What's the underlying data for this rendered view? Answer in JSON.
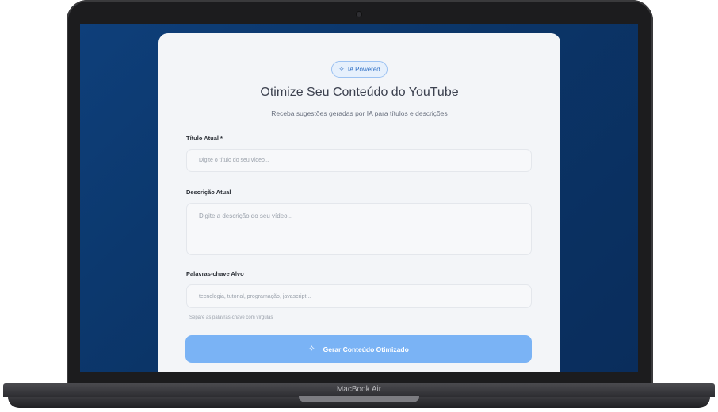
{
  "device": {
    "model_label": "MacBook Air"
  },
  "form": {
    "badge": {
      "icon": "sparkle-icon",
      "label": "IA Powered"
    },
    "title": "Otimize Seu Conteúdo do YouTube",
    "subtitle": "Receba sugestões geradas por IA para títulos e descrições",
    "title_field": {
      "label": "Título Atual *",
      "placeholder": "Digite o título do seu vídeo..."
    },
    "description_field": {
      "label": "Descrição Atual",
      "placeholder": "Digite a descrição do seu vídeo..."
    },
    "keywords_field": {
      "label": "Palavras-chave Alvo",
      "placeholder": "tecnologia, tutorial, programação, javascript...",
      "hint": "Separe as palavras-chave com vírgulas"
    },
    "submit": {
      "icon": "sparkle-icon",
      "label": "Gerar Conteúdo Otimizado"
    }
  },
  "colors": {
    "screen_background": "#0b3568",
    "card_background": "#f3f5f8",
    "accent": "#7ab3f5",
    "badge_text": "#2f6fc4"
  }
}
